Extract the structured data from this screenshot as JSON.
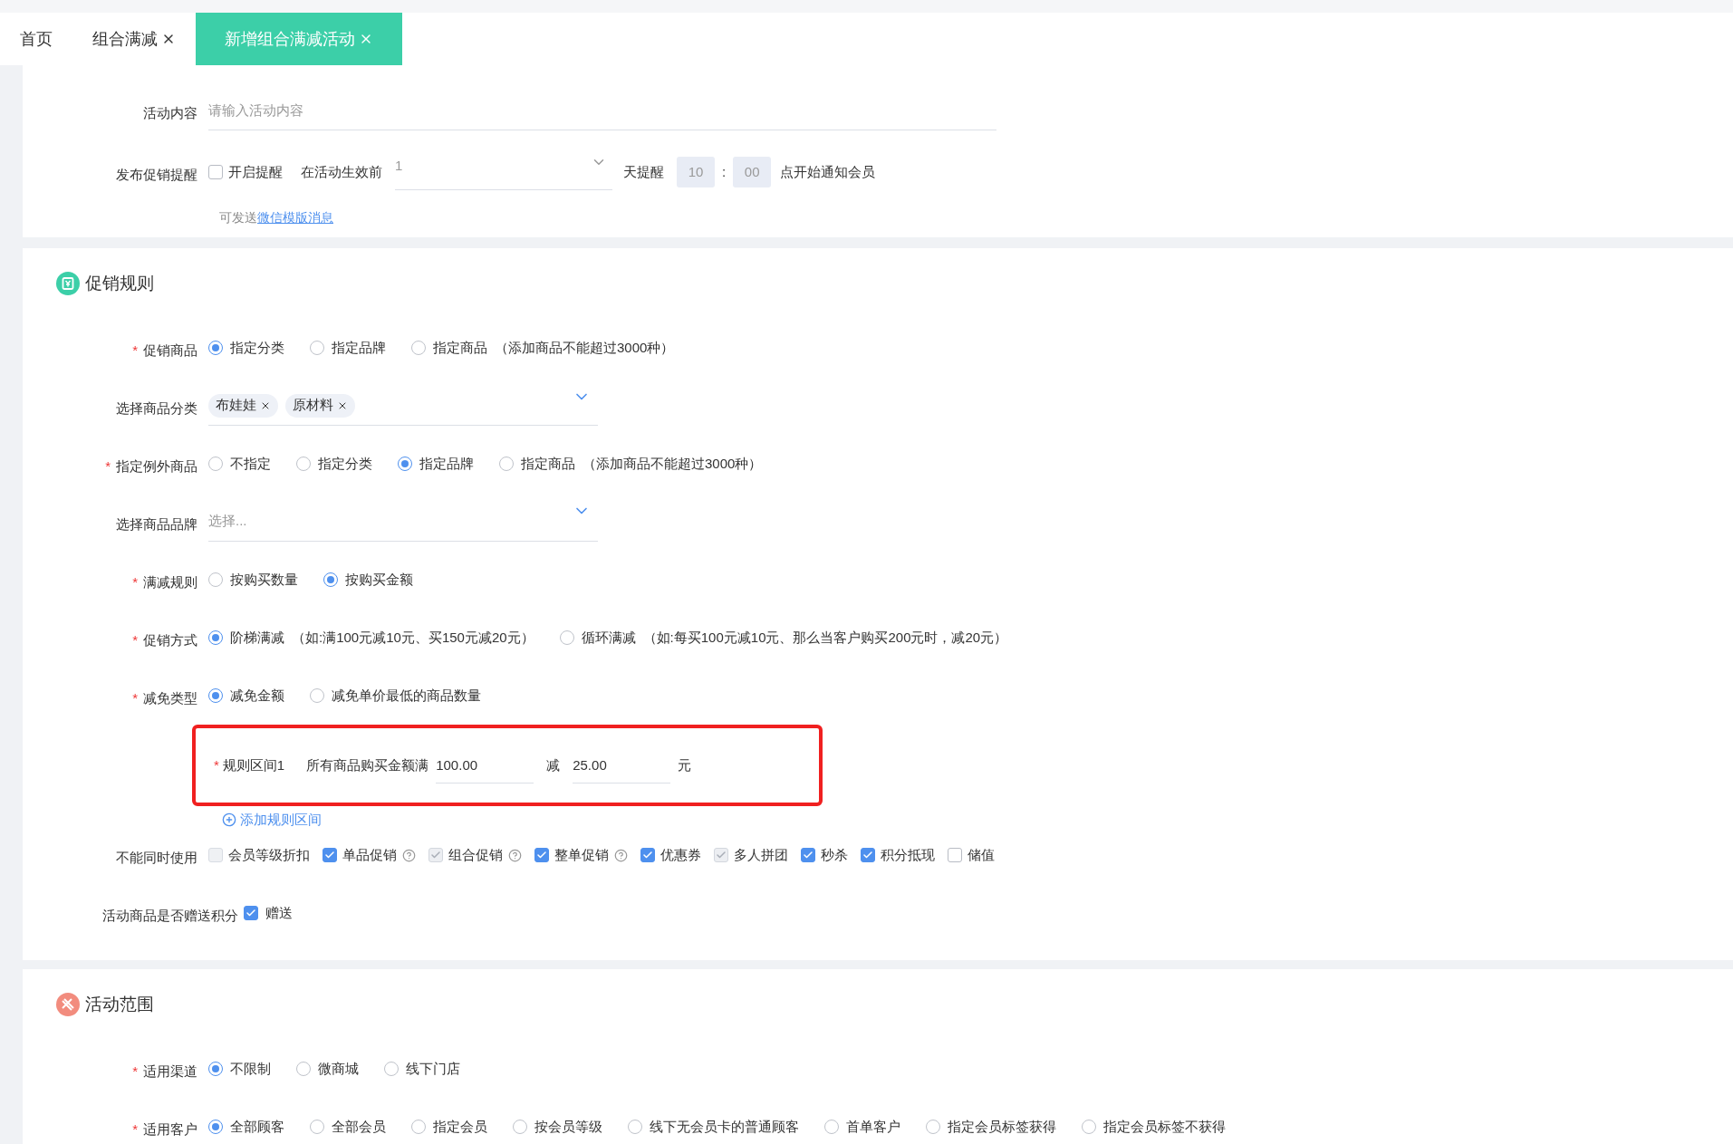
{
  "tabs": [
    {
      "label": "首页",
      "closable": false,
      "selected": false
    },
    {
      "label": "组合满减",
      "closable": true,
      "selected": false
    },
    {
      "label": "新增组合满减活动",
      "closable": true,
      "selected": true
    }
  ],
  "basic": {
    "content": {
      "label": "活动内容",
      "placeholder": "请输入活动内容"
    },
    "reminder": {
      "label": "发布促销提醒",
      "checkbox": {
        "label": "开启提醒",
        "checked": false
      },
      "before_label": "在活动生效前",
      "days_value": "1",
      "days_suffix": "天提醒",
      "hour": "10",
      "separator": ":",
      "minute": "00",
      "suffix": "点开始通知会员"
    },
    "note": {
      "text": "可发送",
      "link": "微信模版消息"
    }
  },
  "rules": {
    "title": "促销规则",
    "fields": [
      {
        "kind": "radio",
        "marker": "*",
        "label": "促销商品",
        "options": [
          {
            "label": "指定分类",
            "selected": true
          },
          {
            "label": "指定品牌",
            "selected": false
          },
          {
            "label": "指定商品",
            "selected": false,
            "hint": "（添加商品不能超过3000种）"
          }
        ]
      },
      {
        "kind": "tags",
        "label": "选择商品分类",
        "tags": [
          "布娃娃",
          "原材料"
        ]
      },
      {
        "kind": "radio",
        "marker": "*",
        "label": "指定例外商品",
        "options": [
          {
            "label": "不指定",
            "selected": false
          },
          {
            "label": "指定分类",
            "selected": false
          },
          {
            "label": "指定品牌",
            "selected": true
          },
          {
            "label": "指定商品",
            "selected": false,
            "hint": "（添加商品不能超过3000种）"
          }
        ]
      },
      {
        "kind": "select",
        "label": "选择商品品牌",
        "placeholder": "选择..."
      },
      {
        "kind": "radio",
        "marker": "*",
        "label": "满减规则",
        "options": [
          {
            "label": "按购买数量",
            "selected": false
          },
          {
            "label": "按购买金额",
            "selected": true
          }
        ]
      },
      {
        "kind": "radio",
        "marker": "*",
        "label": "促销方式",
        "options": [
          {
            "label": "阶梯满减",
            "selected": true,
            "hint": "（如:满100元减10元、买150元减20元）"
          },
          {
            "label": "循环满减",
            "selected": false,
            "hint": "（如:每买100元减10元、那么当客户购买200元时，减20元）"
          }
        ]
      },
      {
        "kind": "radio",
        "marker": "*",
        "label": "减免类型",
        "options": [
          {
            "label": "减免金额",
            "selected": true
          },
          {
            "label": "减免单价最低的商品数量",
            "selected": false
          }
        ]
      }
    ],
    "interval": {
      "marker": "*",
      "label": "规则区间1",
      "prefix": "所有商品购买金额满",
      "amount": "100.00",
      "minus": "减",
      "discount": "25.00",
      "unit": "元",
      "highlighted": true
    },
    "add_interval": "添加规则区间",
    "exclusive": {
      "label": "不能同时使用",
      "options": [
        {
          "label": "会员等级折扣",
          "checked": false,
          "disabled": true,
          "help": false
        },
        {
          "label": "单品促销",
          "checked": true,
          "disabled": false,
          "help": true
        },
        {
          "label": "组合促销",
          "checked": true,
          "disabled": true,
          "help": true
        },
        {
          "label": "整单促销",
          "checked": true,
          "disabled": false,
          "help": true
        },
        {
          "label": "优惠券",
          "checked": true,
          "disabled": false,
          "help": false
        },
        {
          "label": "多人拼团",
          "checked": true,
          "disabled": true,
          "help": false
        },
        {
          "label": "秒杀",
          "checked": true,
          "disabled": false,
          "help": false
        },
        {
          "label": "积分抵现",
          "checked": true,
          "disabled": false,
          "help": false
        },
        {
          "label": "储值",
          "checked": false,
          "disabled": false,
          "help": false
        }
      ]
    },
    "points": {
      "label": "活动商品是否赠送积分",
      "checkbox": {
        "label": "赠送",
        "checked": true
      }
    }
  },
  "scope": {
    "title": "活动范围",
    "fields": [
      {
        "kind": "radio",
        "marker": "*",
        "label": "适用渠道",
        "options": [
          {
            "label": "不限制",
            "selected": true
          },
          {
            "label": "微商城",
            "selected": false
          },
          {
            "label": "线下门店",
            "selected": false
          }
        ]
      },
      {
        "kind": "radio",
        "marker": "*",
        "label": "适用客户",
        "options": [
          {
            "label": "全部顾客",
            "selected": true
          },
          {
            "label": "全部会员",
            "selected": false
          },
          {
            "label": "指定会员",
            "selected": false
          },
          {
            "label": "按会员等级",
            "selected": false
          },
          {
            "label": "线下无会员卡的普通顾客",
            "selected": false
          },
          {
            "label": "首单客户",
            "selected": false
          },
          {
            "label": "指定会员标签获得",
            "selected": false
          },
          {
            "label": "指定会员标签不获得",
            "selected": false
          }
        ]
      }
    ]
  }
}
